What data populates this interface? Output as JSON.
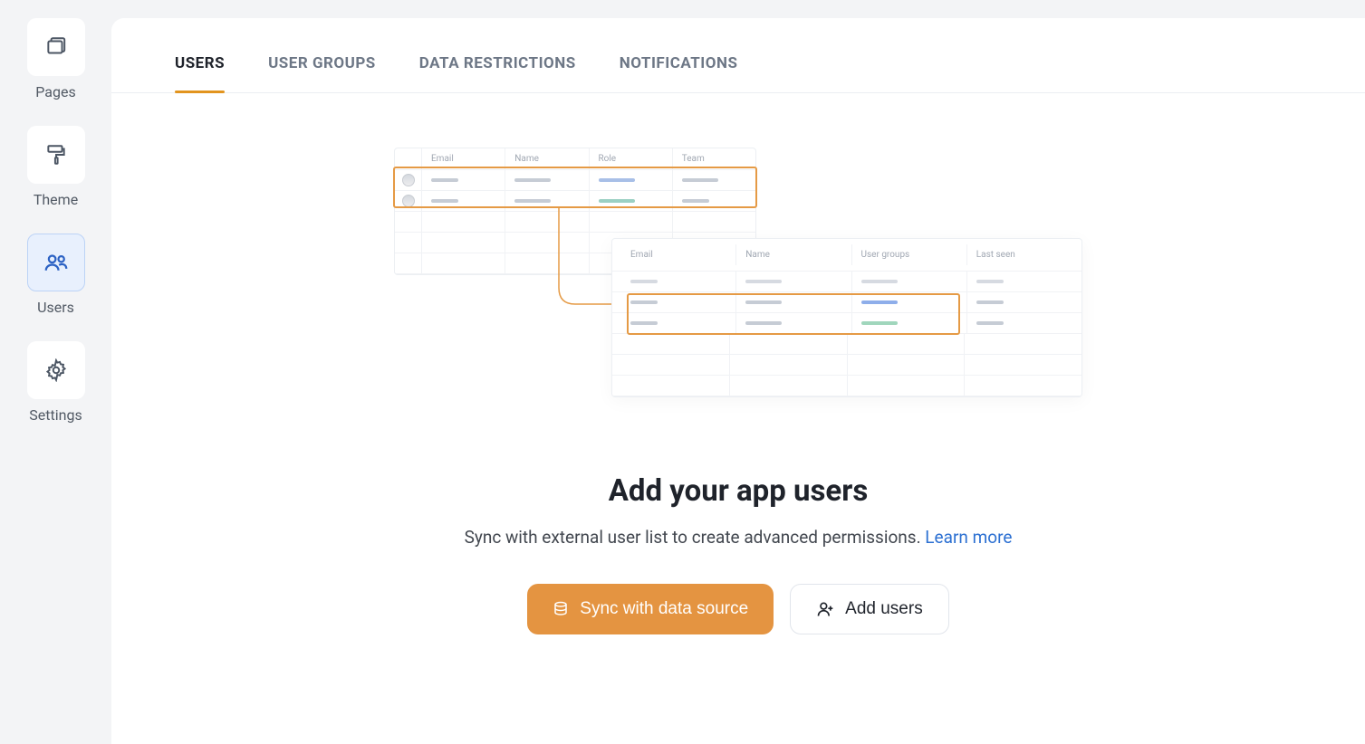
{
  "sidebar": {
    "items": [
      {
        "label": "Pages"
      },
      {
        "label": "Theme"
      },
      {
        "label": "Users"
      },
      {
        "label": "Settings"
      }
    ]
  },
  "tabs": [
    {
      "label": "USERS"
    },
    {
      "label": "USER GROUPS"
    },
    {
      "label": "DATA RESTRICTIONS"
    },
    {
      "label": "NOTIFICATIONS"
    }
  ],
  "illustration": {
    "top_headers": [
      "Email",
      "Name",
      "Role",
      "Team"
    ],
    "bottom_headers": [
      "Email",
      "Name",
      "User groups",
      "Last seen"
    ]
  },
  "empty_state": {
    "title": "Add your app users",
    "subtitle": "Sync with external user list to create advanced permissions. ",
    "learn_more": "Learn more",
    "sync_button": "Sync with data source",
    "add_button": "Add users"
  }
}
